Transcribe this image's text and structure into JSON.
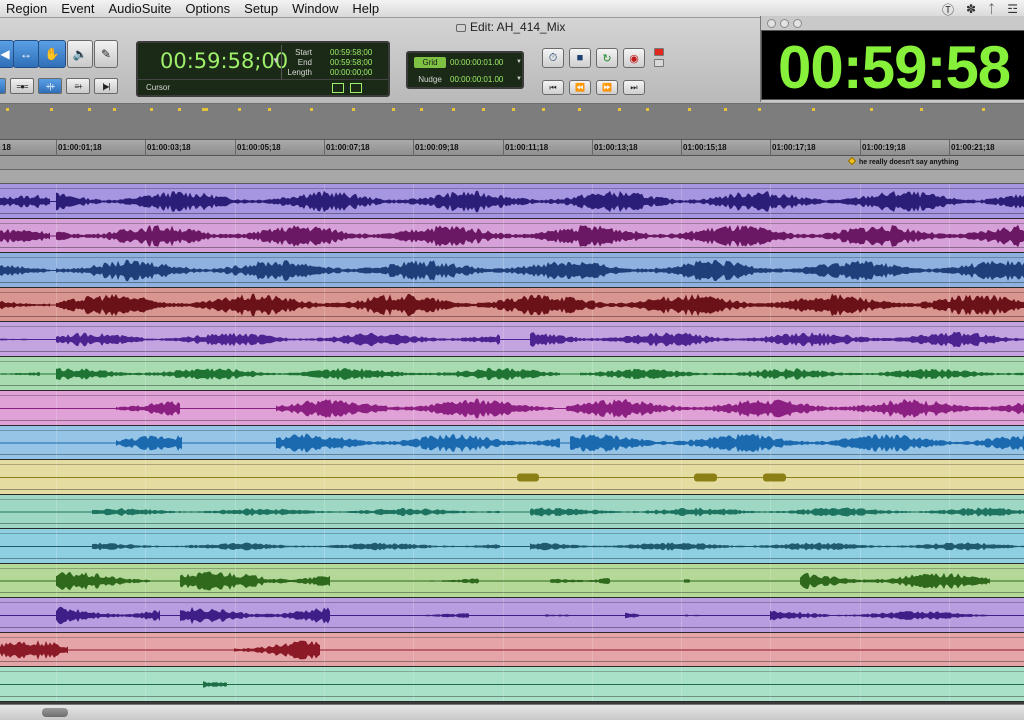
{
  "menubar": {
    "items": [
      "Region",
      "Event",
      "AudioSuite",
      "Options",
      "Setup",
      "Window",
      "Help"
    ],
    "tray_icons": [
      "skype-icon",
      "extension-icon",
      "bluetooth-icon",
      "wifi-icon"
    ]
  },
  "window": {
    "title": "Edit: AH_414_Mix"
  },
  "toolbar": {
    "tools": [
      "zoom-tool",
      "trim-tool",
      "selector-tool",
      "grabber-tool",
      "speaker-tool",
      "pencil-tool"
    ],
    "counter": {
      "main": "00:59:58;00",
      "start_label": "Start",
      "start": "00:59:58;00",
      "end_label": "End",
      "end": "00:59:58;00",
      "length_label": "Length",
      "length": "00:00:00;00",
      "cursor_label": "Cursor"
    },
    "grid": {
      "label": "Grid",
      "value": "00:00:00:01.00"
    },
    "nudge": {
      "label": "Nudge",
      "value": "00:00:00:01.00"
    }
  },
  "big_counter": {
    "time": "00:59:58"
  },
  "ruler": {
    "labels": [
      "01:00:01;18",
      "01:00:03;18",
      "01:00:05;18",
      "01:00:07;18",
      "01:00:09;18",
      "01:00:11;18",
      "01:00:13;18",
      "01:00:15;18",
      "01:00:17;18",
      "01:00:19;18",
      "01:00:21;18"
    ],
    "left_fragment": "18"
  },
  "marker": {
    "text": "he really doesn't say anything"
  },
  "colors": {
    "tracks": [
      {
        "bg": "#a695e0",
        "wave": "#2b1e78"
      },
      {
        "bg": "#d6a1d8",
        "wave": "#6a1764"
      },
      {
        "bg": "#8fb1e0",
        "wave": "#1e3f7a"
      },
      {
        "bg": "#d99590",
        "wave": "#6a1218"
      },
      {
        "bg": "#c4a4e0",
        "wave": "#4c2391"
      },
      {
        "bg": "#a8dcb0",
        "wave": "#1f7434"
      },
      {
        "bg": "#e0a2d6",
        "wave": "#8c1f82"
      },
      {
        "bg": "#96c4e6",
        "wave": "#1b6ab0"
      },
      {
        "bg": "#e4dca0",
        "wave": "#8c7f16"
      },
      {
        "bg": "#9ed8c4",
        "wave": "#1d7460"
      },
      {
        "bg": "#8ed0e2",
        "wave": "#1f5a70"
      },
      {
        "bg": "#b4d898",
        "wave": "#2f6a1c"
      },
      {
        "bg": "#b89ee0",
        "wave": "#3e1f88"
      },
      {
        "bg": "#e4a4a8",
        "wave": "#8c1a26"
      },
      {
        "bg": "#a8e0c8",
        "wave": "#1d6e44"
      }
    ]
  }
}
